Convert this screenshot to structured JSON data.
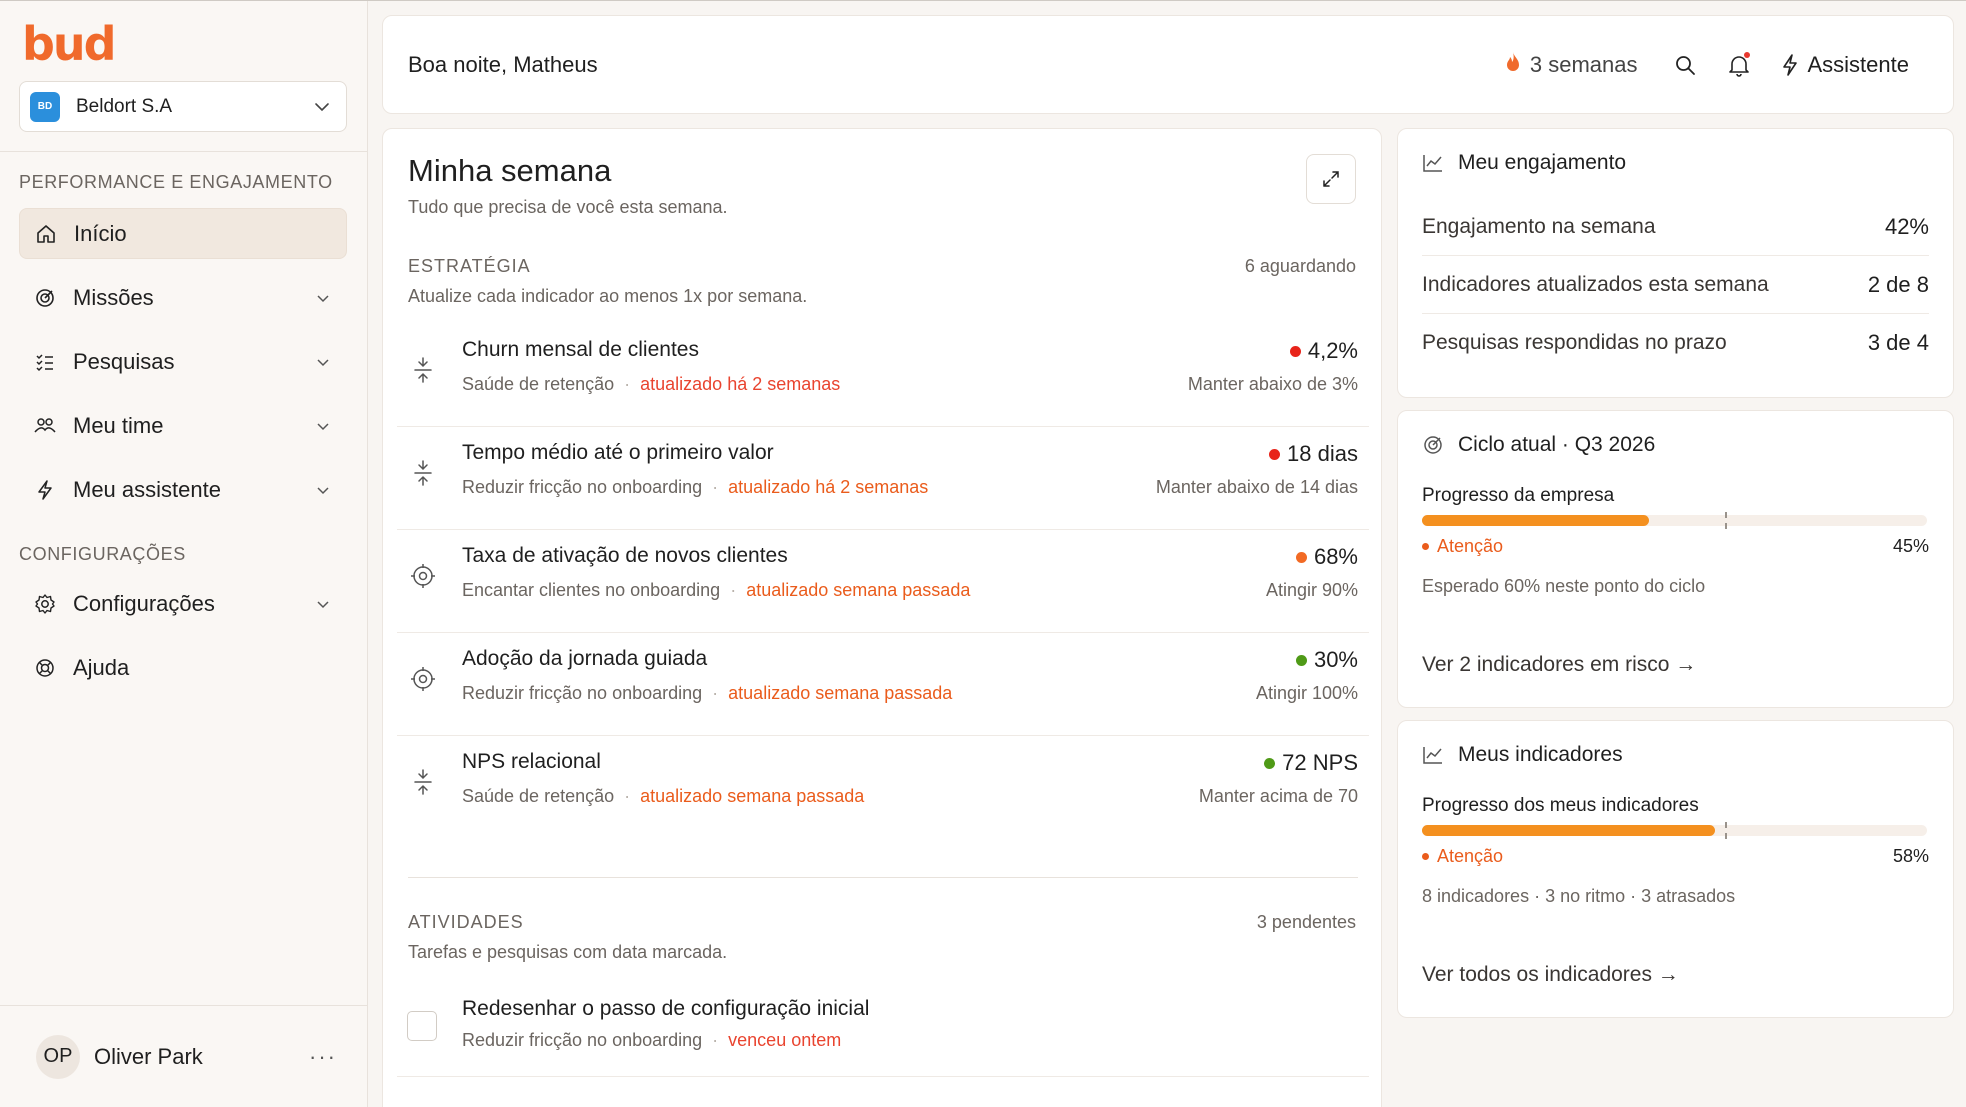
{
  "brand": {
    "logo": "bud",
    "accent": "#f06a2c"
  },
  "org": {
    "badge": "BD",
    "name": "Beldort S.A"
  },
  "sidebar": {
    "section1": "PERFORMANCE E ENGAJAMENTO",
    "items": [
      {
        "label": "Início",
        "icon": "home-icon",
        "active": true
      },
      {
        "label": "Missões",
        "icon": "target-icon"
      },
      {
        "label": "Pesquisas",
        "icon": "checklist-icon"
      },
      {
        "label": "Meu time",
        "icon": "team-icon"
      },
      {
        "label": "Meu assistente",
        "icon": "bolt-icon"
      }
    ],
    "section2": "CONFIGURAÇÕES",
    "settings_items": [
      {
        "label": "Configurações",
        "icon": "gear-icon"
      },
      {
        "label": "Ajuda",
        "icon": "lifebuoy-icon"
      }
    ],
    "user": {
      "initials": "OP",
      "name": "Oliver Park",
      "more": "···"
    }
  },
  "topbar": {
    "greeting": "Boa noite, Matheus",
    "streak": "3 semanas",
    "assistant": "Assistente"
  },
  "week": {
    "title": "Minha semana",
    "subtitle": "Tudo que precisa de você esta semana.",
    "strategy": {
      "label": "ESTRATÉGIA",
      "count": "6 aguardando",
      "desc": "Atualize cada indicador ao menos 1x por semana.",
      "rows": [
        {
          "title": "Churn mensal de clientes",
          "context": "Saúde de retenção",
          "updated": "atualizado há 2 semanas",
          "value": "4,2%",
          "dot": "#e8241a",
          "target": "Manter abaixo de 3%",
          "icon": "decrease-arrows-icon"
        },
        {
          "title": "Tempo médio até o primeiro valor",
          "context": "Reduzir fricção no onboarding",
          "updated": "atualizado há 2 semanas",
          "value": "18 dias",
          "dot": "#e8241a",
          "target": "Manter abaixo de 14 dias",
          "icon": "decrease-arrows-icon"
        },
        {
          "title": "Taxa de ativação de novos clientes",
          "context": "Encantar clientes no onboarding",
          "updated": "atualizado semana passada",
          "value": "68%",
          "dot": "#f26a24",
          "target": "Atingir 90%",
          "icon": "crosshair-icon"
        },
        {
          "title": "Adoção da jornada guiada",
          "context": "Reduzir fricção no onboarding",
          "updated": "atualizado semana passada",
          "value": "30%",
          "dot": "#4f9a17",
          "target": "Atingir 100%",
          "icon": "crosshair-icon"
        },
        {
          "title": "NPS relacional",
          "context": "Saúde de retenção",
          "updated": "atualizado semana passada",
          "value": "72 NPS",
          "dot": "#4f9a17",
          "target": "Manter acima de 70",
          "icon": "decrease-arrows-icon"
        }
      ]
    },
    "activities": {
      "label": "ATIVIDADES",
      "count": "3 pendentes",
      "desc": "Tarefas e pesquisas com data marcada.",
      "rows": [
        {
          "title": "Redesenhar o passo de configuração inicial",
          "context": "Reduzir fricção no onboarding",
          "due": "venceu ontem"
        }
      ]
    }
  },
  "engagement": {
    "title": "Meu engajamento",
    "rows": [
      {
        "label": "Engajamento na semana",
        "value": "42%"
      },
      {
        "label": "Indicadores atualizados esta semana",
        "value": "2 de 8"
      },
      {
        "label": "Pesquisas respondidas no prazo",
        "value": "3 de 4"
      }
    ]
  },
  "cycle": {
    "title": "Ciclo atual · Q3 2026",
    "progress_label": "Progresso da empresa",
    "progress": 0.45,
    "expected": 0.6,
    "status": "Atenção",
    "percent": "45%",
    "note": "Esperado 60% neste ponto do ciclo",
    "link": "Ver 2 indicadores em risco →"
  },
  "my_indicators": {
    "title": "Meus indicadores",
    "progress_label": "Progresso dos meus indicadores",
    "progress": 0.58,
    "expected": 0.6,
    "status": "Atenção",
    "percent": "58%",
    "note": "8 indicadores · 3 no ritmo · 3 atrasados",
    "link": "Ver todos os indicadores →"
  }
}
